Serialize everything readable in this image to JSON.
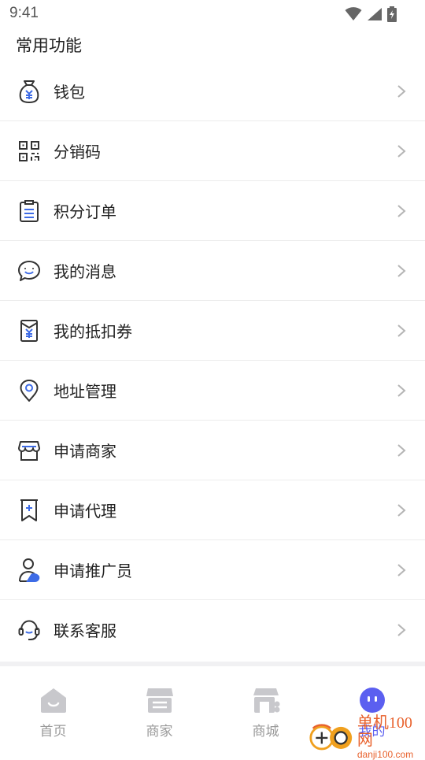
{
  "status_bar": {
    "time": "9:41"
  },
  "section": {
    "title": "常用功能"
  },
  "menu": {
    "items": [
      {
        "label": "钱包",
        "icon": "wallet-icon"
      },
      {
        "label": "分销码",
        "icon": "qr-code-icon"
      },
      {
        "label": "积分订单",
        "icon": "clipboard-icon"
      },
      {
        "label": "我的消息",
        "icon": "message-bubble-icon"
      },
      {
        "label": "我的抵扣券",
        "icon": "coupon-icon"
      },
      {
        "label": "地址管理",
        "icon": "location-pin-icon"
      },
      {
        "label": "申请商家",
        "icon": "storefront-icon"
      },
      {
        "label": "申请代理",
        "icon": "bookmark-plus-icon"
      },
      {
        "label": "申请推广员",
        "icon": "promoter-icon"
      },
      {
        "label": "联系客服",
        "icon": "headset-icon"
      }
    ]
  },
  "tabbar": {
    "tabs": [
      {
        "label": "首页",
        "icon": "home-icon"
      },
      {
        "label": "商家",
        "icon": "shop-icon"
      },
      {
        "label": "商城",
        "icon": "mall-icon"
      },
      {
        "label": "我的",
        "icon": "profile-face-icon",
        "active": true
      }
    ]
  },
  "watermark": {
    "line1": "单机100网",
    "line2": "danji100.com"
  },
  "colors": {
    "accent": "#5b5ff0",
    "icon_stroke": "#333333",
    "icon_accent": "#3d6be6",
    "tab_inactive": "#c8c8cc"
  }
}
